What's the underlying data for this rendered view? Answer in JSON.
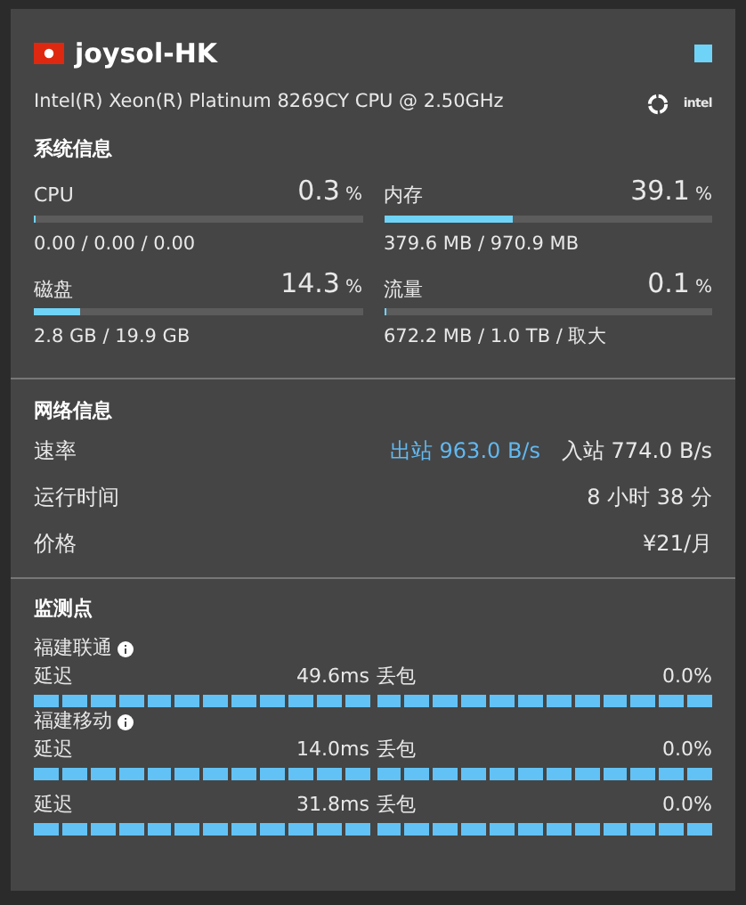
{
  "server": {
    "name": "joysol-HK",
    "online": true,
    "cpu_model": "Intel(R) Xeon(R) Platinum 8269CY CPU @ 2.50GHz",
    "logo_text": "intel"
  },
  "system": {
    "title": "系统信息",
    "metrics": [
      {
        "label": "CPU",
        "value": "0.3",
        "unit": "%",
        "level": 0.003,
        "detail": "0.00 / 0.00 / 0.00"
      },
      {
        "label": "内存",
        "value": "39.1",
        "unit": "%",
        "level": 0.391,
        "detail": "379.6 MB / 970.9 MB"
      },
      {
        "label": "磁盘",
        "value": "14.3",
        "unit": "%",
        "level": 0.143,
        "detail": "2.8 GB / 19.9 GB"
      },
      {
        "label": "流量",
        "value": "0.1",
        "unit": "%",
        "level": 0.001,
        "detail": "672.2 MB / 1.0 TB / 取大"
      }
    ]
  },
  "network": {
    "title": "网络信息",
    "rows": [
      {
        "label": "速率",
        "kind": "speed",
        "out": "出站 963.0 B/s",
        "in": "入站 774.0 B/s"
      },
      {
        "label": "运行时间",
        "kind": "text",
        "value": "8 小时 38 分"
      },
      {
        "label": "价格",
        "kind": "text",
        "value": "¥21/月"
      }
    ]
  },
  "monitor": {
    "title": "监测点",
    "groups": [
      {
        "name": "福建联通",
        "latency": {
          "label": "延迟",
          "value": "49.6ms"
        },
        "loss": {
          "label": "丢包",
          "value": "0.0%"
        }
      },
      {
        "name": "福建移动",
        "latency": {
          "label": "延迟",
          "value": "14.0ms"
        },
        "loss": {
          "label": "丢包",
          "value": "0.0%"
        }
      },
      {
        "latency": {
          "label": "延迟",
          "value": "31.8ms"
        },
        "loss": {
          "label": "丢包",
          "value": "0.0%"
        }
      }
    ]
  }
}
